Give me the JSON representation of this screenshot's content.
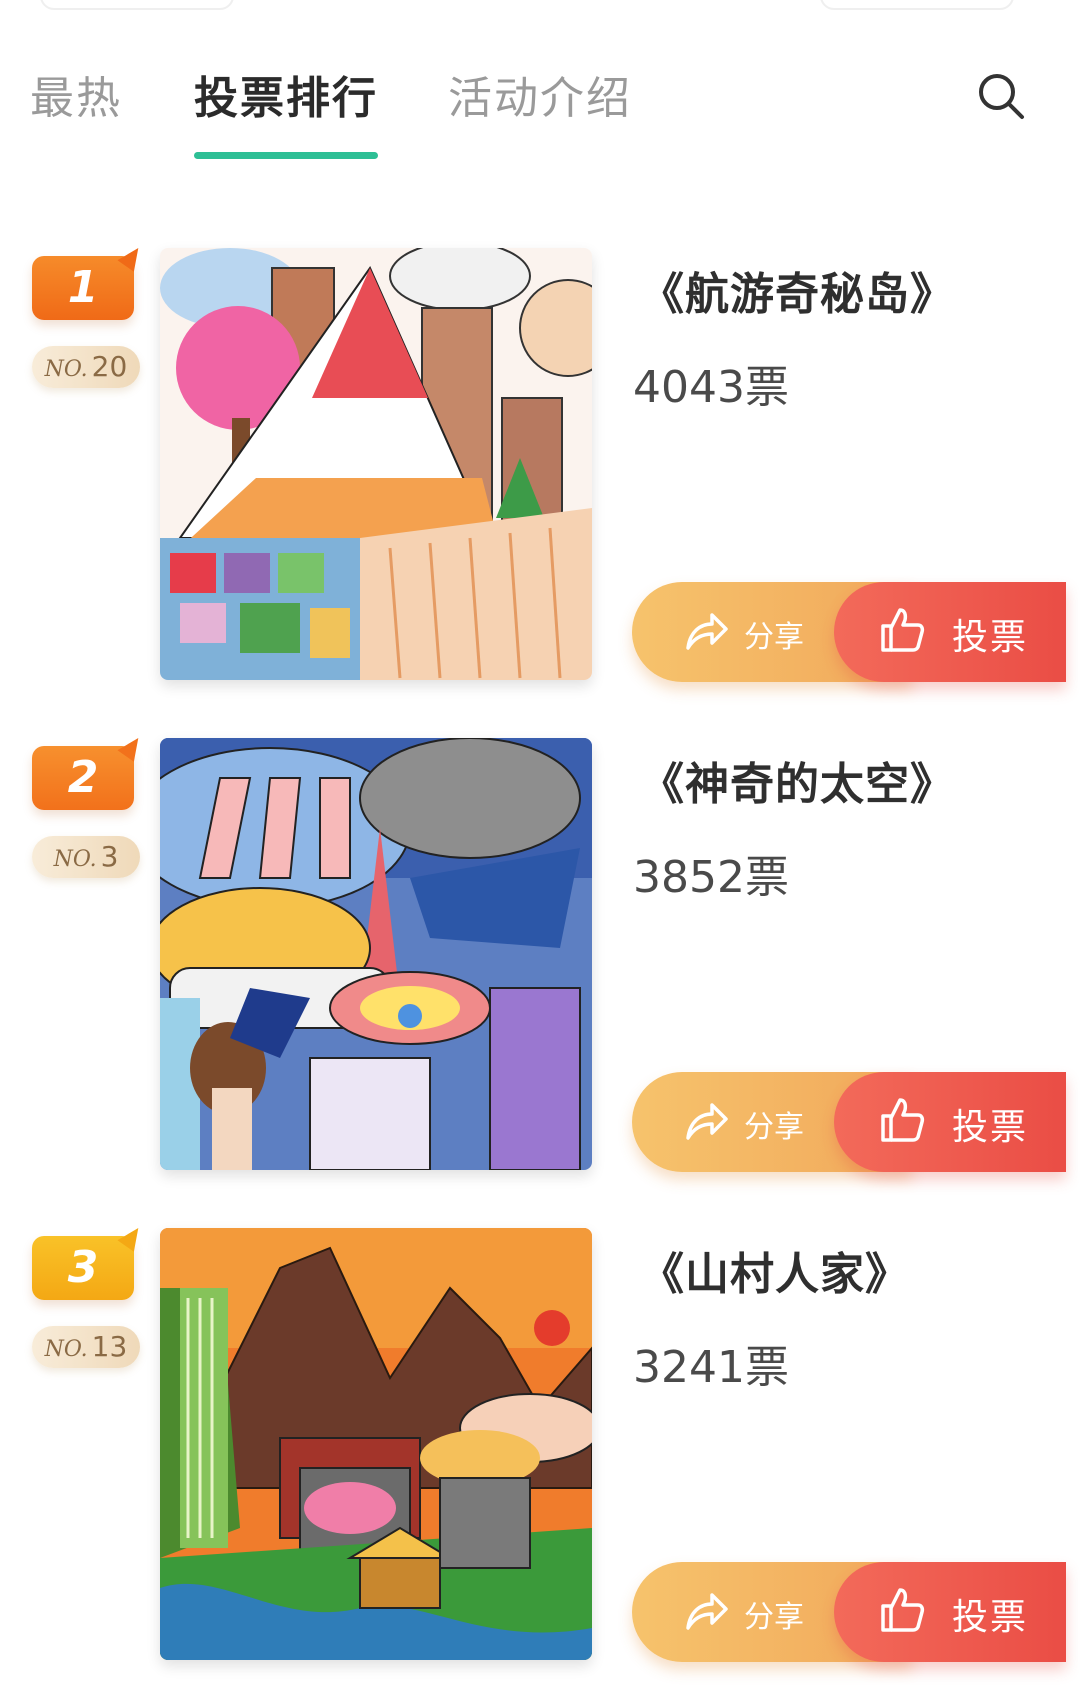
{
  "tabs": [
    {
      "label": "最热",
      "active": false
    },
    {
      "label": "投票排行",
      "active": true
    },
    {
      "label": "活动介绍",
      "active": false
    }
  ],
  "accent_color": "#2dbf95",
  "search_icon": "search-icon",
  "entries": [
    {
      "rank": "1",
      "rank_color": "#f27a1f",
      "no_prefix": "NO.",
      "no": "20",
      "title": "《航游奇秘岛》",
      "votes": "4043票",
      "share_label": "分享",
      "vote_label": "投票"
    },
    {
      "rank": "2",
      "rank_color": "#f47f22",
      "no_prefix": "NO.",
      "no": "3",
      "title": "《神奇的太空》",
      "votes": "3852票",
      "share_label": "分享",
      "vote_label": "投票"
    },
    {
      "rank": "3",
      "rank_color": "#f7b318",
      "no_prefix": "NO.",
      "no": "13",
      "title": "《山村人家》",
      "votes": "3241票",
      "share_label": "分享",
      "vote_label": "投票"
    }
  ]
}
